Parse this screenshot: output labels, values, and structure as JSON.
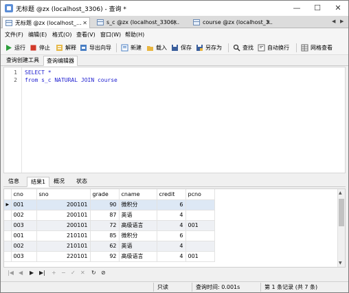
{
  "window": {
    "title": "无标题 @zx (localhost_3306) - 查询 *",
    "minimize": "—",
    "maximize": "☐",
    "close": "✕"
  },
  "tabs": [
    {
      "label": "无标题 @zx (localhost_...",
      "close": "✕"
    },
    {
      "label": "s_c @zx (localhost_3306)...",
      "close": "✕"
    },
    {
      "label": "course @zx (localhost_3...",
      "close": "✕"
    }
  ],
  "menu": [
    "文件(F)",
    "编辑(E)",
    "格式(O)",
    "查看(V)",
    "窗口(W)",
    "帮助(H)"
  ],
  "toolbar": {
    "run": "运行",
    "stop": "停止",
    "explain": "解释",
    "export": "导出向导",
    "new": "新建",
    "load": "载入",
    "save": "保存",
    "save_as": "另存为",
    "find": "查找",
    "auto_wrap": "自动换行",
    "grid_view": "网格查看"
  },
  "subtabs": [
    "查询创建工具",
    "查询编辑器"
  ],
  "editor": {
    "lines": [
      {
        "n": "1",
        "code": "SELECT *"
      },
      {
        "n": "2",
        "code": "from s_c NATURAL JOIN course"
      }
    ]
  },
  "result_tabs": [
    "信息",
    "结果1",
    "概况",
    "状态"
  ],
  "grid": {
    "columns": [
      "cno",
      "sno",
      "grade",
      "cname",
      "credit",
      "pcno"
    ],
    "rows": [
      [
        "001",
        "200101",
        "90",
        "微积分",
        "6",
        ""
      ],
      [
        "002",
        "200101",
        "87",
        "英语",
        "4",
        ""
      ],
      [
        "003",
        "200101",
        "72",
        "高级语言",
        "4",
        "001"
      ],
      [
        "001",
        "210101",
        "85",
        "微积分",
        "6",
        ""
      ],
      [
        "002",
        "210101",
        "62",
        "英语",
        "4",
        ""
      ],
      [
        "003",
        "220101",
        "92",
        "高级语言",
        "4",
        "001"
      ]
    ]
  },
  "nav": [
    "|◀",
    "◀",
    "▶",
    "▶|",
    "+",
    "−",
    "✓",
    "✕",
    "↻",
    "⊘"
  ],
  "status": {
    "readonly": "只读",
    "query_time": "查询时间: 0.001s",
    "record": "第 1 条记录 (共 7 条)"
  },
  "colors": {
    "keyword": "#1c1ccf",
    "selected_row": "#dde8f5",
    "alt_row": "#eef0f4"
  }
}
